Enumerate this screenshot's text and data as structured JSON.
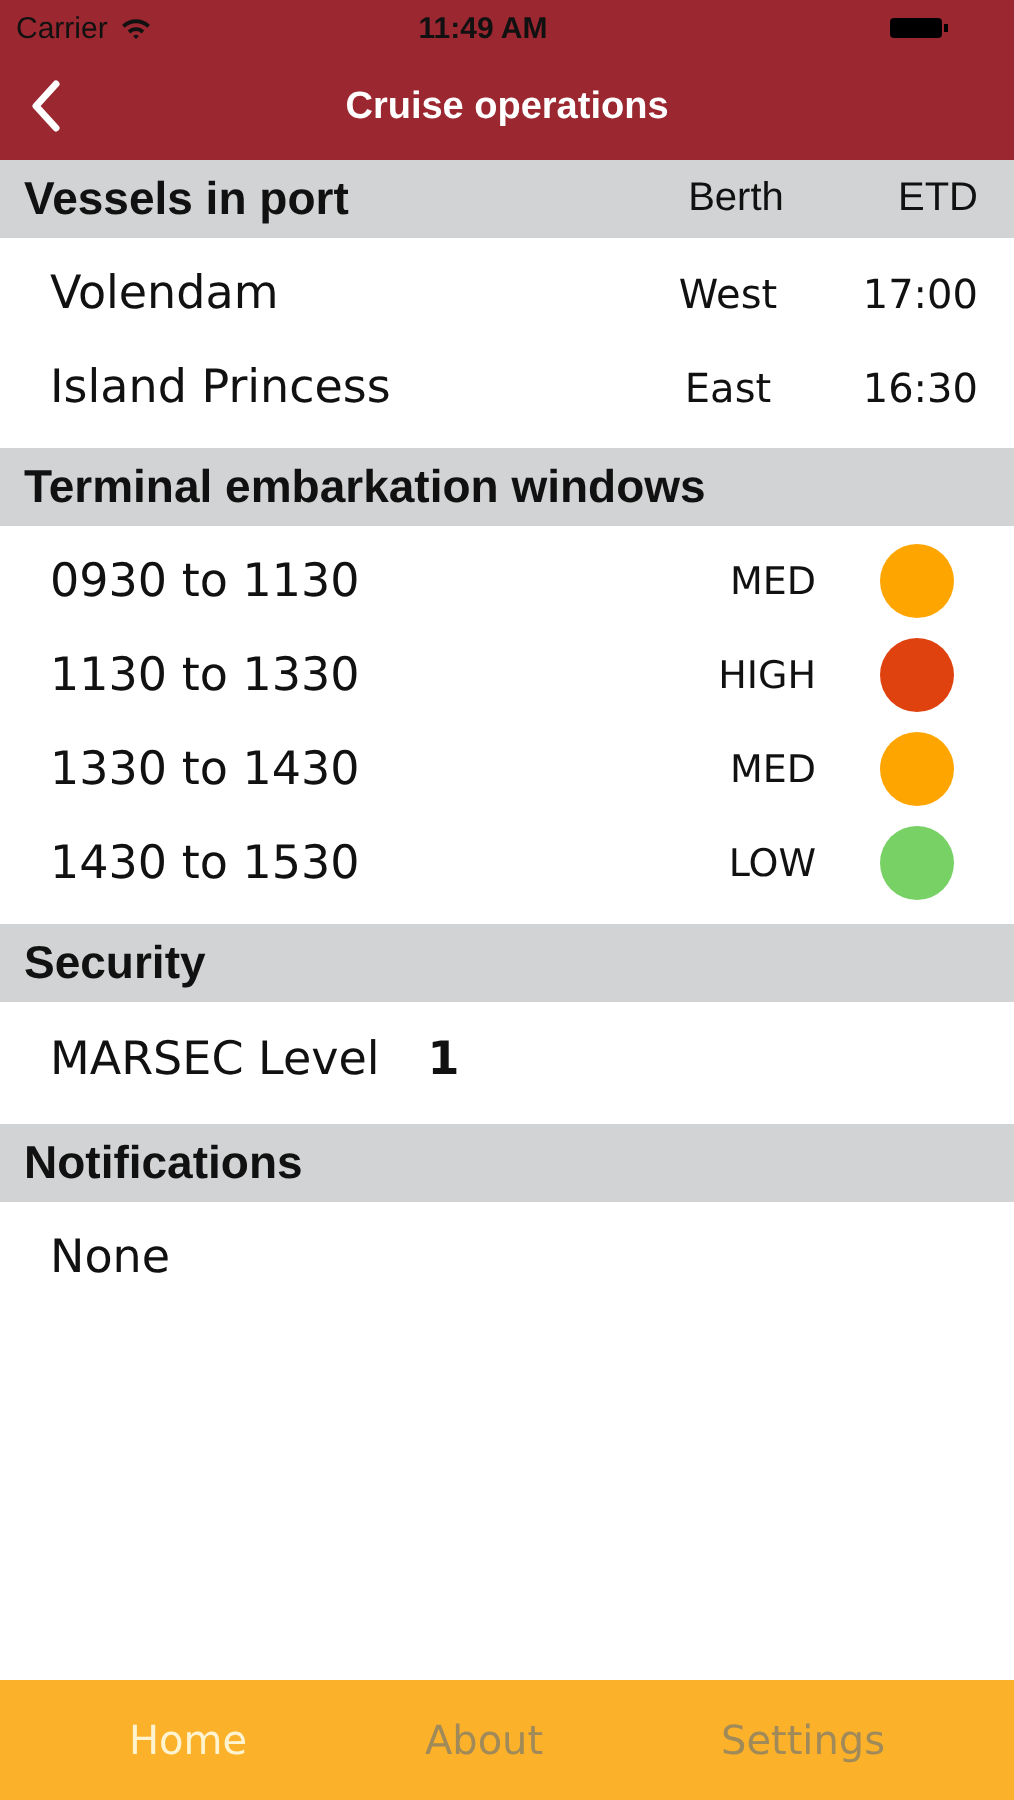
{
  "status_bar": {
    "carrier": "Carrier",
    "time": "11:49 AM"
  },
  "nav_bar": {
    "title": "Cruise operations"
  },
  "sections": [
    {
      "kind": "vessels",
      "title": "Vessels in port",
      "columns": [
        "Berth",
        "ETD"
      ],
      "rows": [
        {
          "name": "Volendam",
          "berth": "West",
          "etd": "17:00"
        },
        {
          "name": "Island Princess",
          "berth": "East",
          "etd": "16:30"
        }
      ]
    },
    {
      "kind": "windows",
      "title": "Terminal embarkation windows",
      "rows": [
        {
          "name": "0930 to 1130",
          "status": "MED",
          "color": "#ffa500"
        },
        {
          "name": "1130 to 1330",
          "status": "HIGH",
          "color": "#e0420f"
        },
        {
          "name": "1330 to 1430",
          "status": "MED",
          "color": "#ffa500"
        },
        {
          "name": "1430 to 1530",
          "status": "LOW",
          "color": "#77d165"
        }
      ]
    },
    {
      "kind": "pair",
      "title": "Security",
      "rows": [
        {
          "name": "MARSEC Level",
          "value": "1"
        }
      ]
    },
    {
      "kind": "text",
      "title": "Notifications",
      "rows": [
        {
          "name": "None"
        }
      ]
    }
  ],
  "tabs": [
    {
      "label": "Home",
      "selected": true
    },
    {
      "label": "About",
      "selected": false
    },
    {
      "label": "Settings",
      "selected": false
    }
  ]
}
